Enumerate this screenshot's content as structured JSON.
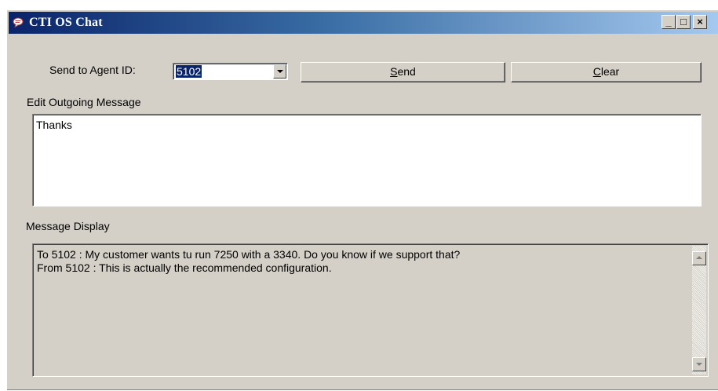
{
  "window": {
    "title": "CTI OS Chat",
    "minimize_label": "_",
    "maximize_label": "□",
    "close_label": "×"
  },
  "send_to": {
    "label": "Send to Agent ID:",
    "selected_agent_id": "5102"
  },
  "buttons": {
    "send_mnemonic": "S",
    "send_rest": "end",
    "clear_mnemonic": "C",
    "clear_rest": "lear"
  },
  "outgoing": {
    "label": "Edit Outgoing Message",
    "value": "Thanks"
  },
  "display": {
    "label": "Message Display",
    "messages": [
      "To 5102 : My customer wants tu run 7250 with a 3340. Do you know if we support that?",
      "From 5102 : This is actually the recommended configuration."
    ]
  },
  "colors": {
    "face": "#d4d0c8",
    "title_start": "#0a246a",
    "title_end": "#a6caf0",
    "selection": "#0a246a"
  }
}
